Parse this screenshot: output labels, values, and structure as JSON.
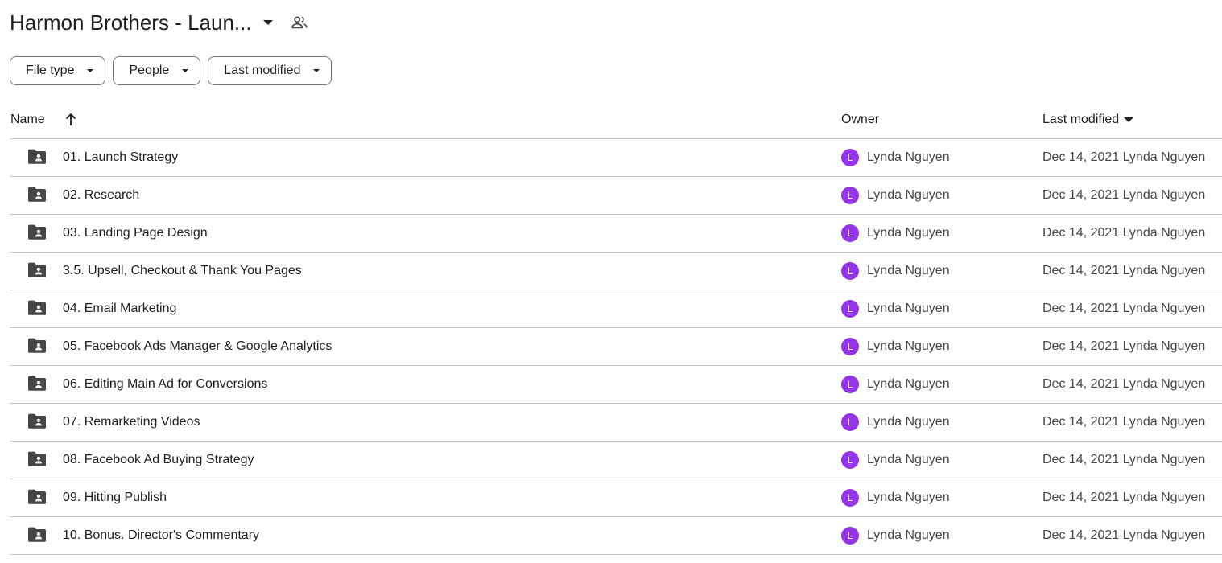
{
  "header": {
    "title": "Harmon Brothers - Laun...",
    "title_dropdown_icon": "caret-down-icon",
    "shared_icon": "shared-folder-people-icon"
  },
  "filters": [
    {
      "label": "File type"
    },
    {
      "label": "People"
    },
    {
      "label": "Last modified"
    }
  ],
  "table": {
    "columns": {
      "name": "Name",
      "owner": "Owner",
      "last_modified": "Last modified"
    },
    "sort_icon": "arrow-up-icon",
    "rows": [
      {
        "name": "01. Launch Strategy",
        "owner": "Lynda Nguyen",
        "avatar": "L",
        "modified": "Dec 14, 2021 Lynda Nguyen"
      },
      {
        "name": "02. Research",
        "owner": "Lynda Nguyen",
        "avatar": "L",
        "modified": "Dec 14, 2021 Lynda Nguyen"
      },
      {
        "name": "03. Landing Page Design",
        "owner": "Lynda Nguyen",
        "avatar": "L",
        "modified": "Dec 14, 2021 Lynda Nguyen"
      },
      {
        "name": "3.5. Upsell, Checkout & Thank You Pages",
        "owner": "Lynda Nguyen",
        "avatar": "L",
        "modified": "Dec 14, 2021 Lynda Nguyen"
      },
      {
        "name": "04. Email Marketing",
        "owner": "Lynda Nguyen",
        "avatar": "L",
        "modified": "Dec 14, 2021 Lynda Nguyen"
      },
      {
        "name": "05. Facebook Ads Manager & Google Analytics",
        "owner": "Lynda Nguyen",
        "avatar": "L",
        "modified": "Dec 14, 2021 Lynda Nguyen"
      },
      {
        "name": "06. Editing Main Ad for Conversions",
        "owner": "Lynda Nguyen",
        "avatar": "L",
        "modified": "Dec 14, 2021 Lynda Nguyen"
      },
      {
        "name": "07. Remarketing Videos",
        "owner": "Lynda Nguyen",
        "avatar": "L",
        "modified": "Dec 14, 2021 Lynda Nguyen"
      },
      {
        "name": "08. Facebook Ad Buying Strategy",
        "owner": "Lynda Nguyen",
        "avatar": "L",
        "modified": "Dec 14, 2021 Lynda Nguyen"
      },
      {
        "name": "09. Hitting Publish",
        "owner": "Lynda Nguyen",
        "avatar": "L",
        "modified": "Dec 14, 2021 Lynda Nguyen"
      },
      {
        "name": "10. Bonus. Director's Commentary",
        "owner": "Lynda Nguyen",
        "avatar": "L",
        "modified": "Dec 14, 2021 Lynda Nguyen"
      }
    ]
  },
  "colors": {
    "avatar": "#9334e6",
    "folder_icon": "#444746",
    "divider": "#c4c7c5",
    "chip_border": "#747775"
  },
  "icons": {
    "row_icon": "shared-folder-icon"
  }
}
